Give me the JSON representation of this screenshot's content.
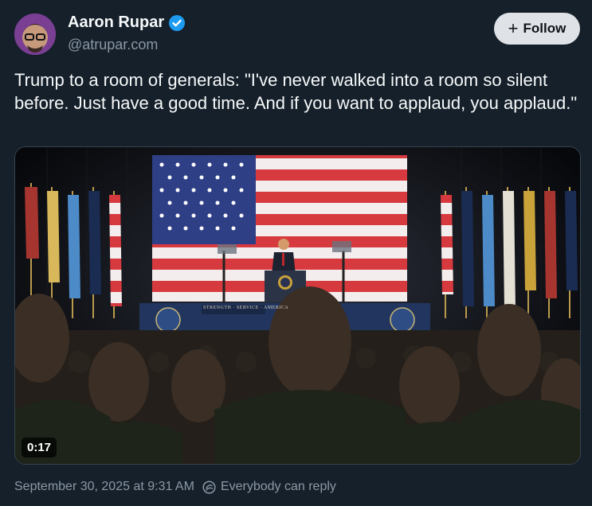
{
  "author": {
    "name": "Aaron Rupar",
    "handle": "@atrupar.com"
  },
  "follow_button": {
    "label": "Follow",
    "icon": "plus-icon"
  },
  "post": {
    "text": "Trump to a room of generals: \"I've never walked into a room so silent before. Just have a good time. And if you want to applaud, you applaud.\""
  },
  "video": {
    "duration": "0:17",
    "podium_sign": "STRENGTH · SERVICE · AMERICA"
  },
  "footer": {
    "timestamp": "September 30, 2025 at 9:31 AM",
    "reply_setting": "Everybody can reply"
  },
  "colors": {
    "background": "#15202b",
    "verified": "#1d9bf0",
    "follow_bg": "#dfe3e8",
    "muted_text": "#8b98a5"
  }
}
